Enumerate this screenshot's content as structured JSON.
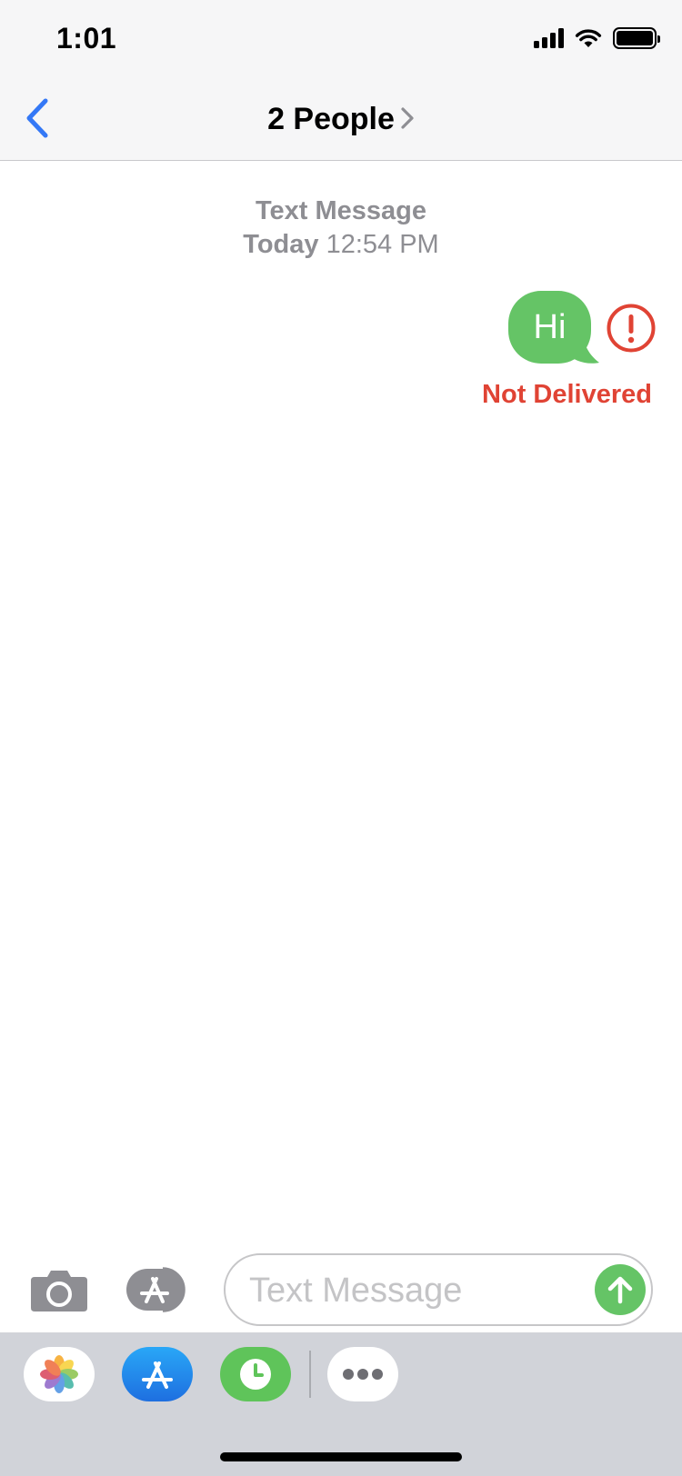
{
  "status_bar": {
    "time": "1:01",
    "icons": [
      "cellular-signal-icon",
      "wifi-icon",
      "battery-icon"
    ]
  },
  "header": {
    "back_icon": "chevron-left-icon",
    "title": "2 People",
    "title_chevron_icon": "chevron-right-icon"
  },
  "conversation": {
    "service_label": "Text Message",
    "date_label": "Today",
    "time_label": "12:54 PM",
    "messages": [
      {
        "text": "Hi",
        "direction": "outgoing",
        "status": "Not Delivered",
        "status_icon": "exclamation-circle-icon"
      }
    ]
  },
  "composer": {
    "camera_icon": "camera-icon",
    "apps_icon": "app-store-icon",
    "placeholder": "Text Message",
    "send_icon": "arrow-up-icon"
  },
  "app_drawer": {
    "apps": [
      {
        "name": "Photos",
        "icon": "photos-icon"
      },
      {
        "name": "App Store",
        "icon": "app-store-icon"
      },
      {
        "name": "Digital Touch",
        "icon": "clock-icon"
      },
      {
        "name": "More",
        "icon": "ellipsis-icon"
      }
    ]
  },
  "colors": {
    "accent_blue": "#3478f6",
    "bubble_green": "#65c466",
    "error_red": "#e04334",
    "meta_gray": "#8e8e93"
  }
}
